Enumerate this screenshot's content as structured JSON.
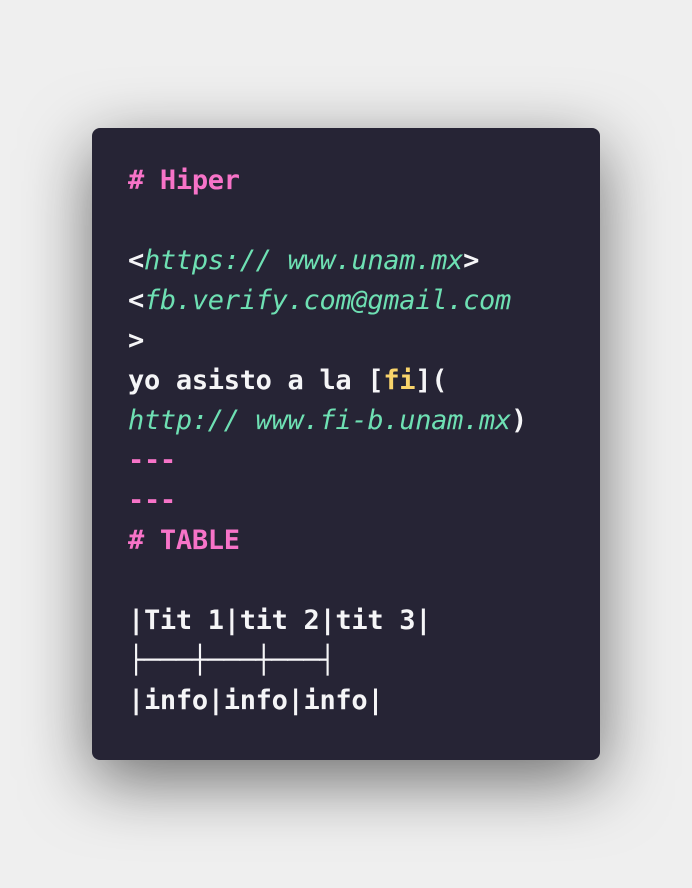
{
  "colors": {
    "background": "#efefef",
    "card": "#262435",
    "text": "#f5f5f7",
    "heading": "#f773c8",
    "link": "#6ee0b3",
    "anchor": "#f9d46b"
  },
  "editor": {
    "heading1": "# Hiper",
    "link1": {
      "open": "<",
      "url": "https:// www.unam.mx",
      "close": ">"
    },
    "link2": {
      "open": "<",
      "url": "fb.verify.com@gmail.com",
      "close": ">"
    },
    "sentence": {
      "text": "yo asisto a la ",
      "bracket_open": "[",
      "anchor": "fi",
      "bracket_close": "](",
      "url": "http:// www.fi-b.unam.mx",
      "paren_close": ")"
    },
    "rule1": "---",
    "rule2": "---",
    "heading2": "# TABLE",
    "table": {
      "header": "|Tit 1|tit 2|tit 3|",
      "separator": "├───┼───┼───┤",
      "row": "|info|info|info|"
    }
  }
}
